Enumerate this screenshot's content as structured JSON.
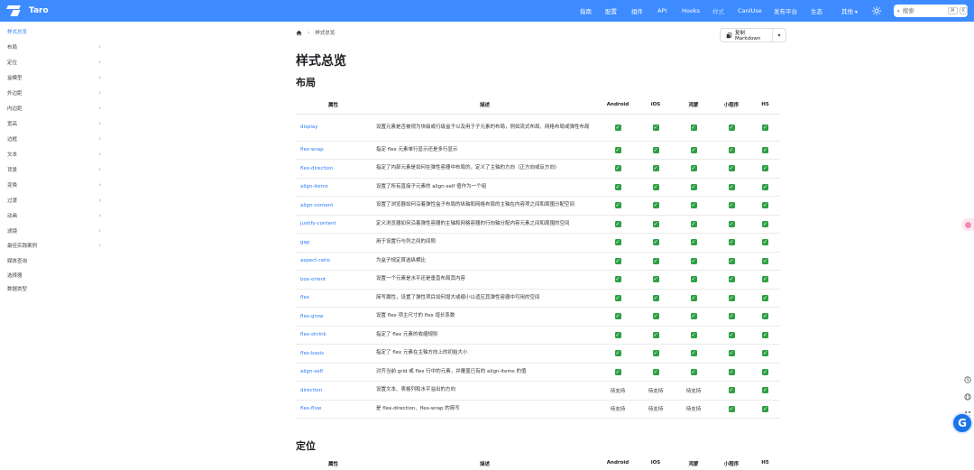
{
  "navbar": {
    "brand": "Taro",
    "items": [
      {
        "label": "指南",
        "muted": false
      },
      {
        "label": "配置",
        "muted": false
      },
      {
        "label": "组件",
        "muted": false
      },
      {
        "label": "API",
        "muted": false
      },
      {
        "label": "Hooks",
        "muted": false
      },
      {
        "label": "样式",
        "muted": true
      },
      {
        "label": "CanIUse",
        "muted": false
      },
      {
        "label": "发布平台",
        "muted": false
      },
      {
        "label": "生态",
        "muted": false
      },
      {
        "label": "其他",
        "muted": false,
        "dropdown": true
      }
    ],
    "search_placeholder": "搜索",
    "search_kbd": [
      "⌘",
      "K"
    ]
  },
  "sidebar": {
    "items": [
      {
        "label": "样式总览",
        "active": true,
        "chevron": false
      },
      {
        "label": "布局",
        "chevron": true
      },
      {
        "label": "定位",
        "chevron": true
      },
      {
        "label": "盒模型",
        "chevron": true
      },
      {
        "label": "外边距",
        "chevron": true
      },
      {
        "label": "内边距",
        "chevron": true
      },
      {
        "label": "宽高",
        "chevron": true
      },
      {
        "label": "边框",
        "chevron": true
      },
      {
        "label": "文本",
        "chevron": true
      },
      {
        "label": "背景",
        "chevron": true
      },
      {
        "label": "变换",
        "chevron": true
      },
      {
        "label": "过渡",
        "chevron": true
      },
      {
        "label": "动画",
        "chevron": true
      },
      {
        "label": "滤镜",
        "chevron": true
      },
      {
        "label": "最佳实践案例",
        "chevron": true
      },
      {
        "label": "媒体查询",
        "chevron": false
      },
      {
        "label": "选择器",
        "chevron": false
      },
      {
        "label": "数据类型",
        "chevron": false
      }
    ]
  },
  "breadcrumb": {
    "current": "样式总览"
  },
  "copy_button": {
    "label": "复制 Markdown"
  },
  "page_title": "样式总览",
  "sections": [
    {
      "title": "布局",
      "headers": [
        "属性",
        "描述",
        "Android",
        "iOS",
        "鸿蒙",
        "小程序",
        "H5"
      ],
      "rows": [
        {
          "prop": "display",
          "desc": "设置元素是否被视为块级或行级盒子以及用于子元素的布局，例如流式布局、网格布局或弹性布局",
          "support": [
            "✓",
            "✓",
            "✓",
            "✓",
            "✓"
          ],
          "tall": true
        },
        {
          "prop": "flex-wrap",
          "desc": "指定 flex 元素单行显示还是多行显示",
          "support": [
            "✓",
            "✓",
            "✓",
            "✓",
            "✓"
          ]
        },
        {
          "prop": "flex-direction",
          "desc": "指定了内部元素是如何在弹性容器中布局的，定义了主轴的方向（正方向或反方向）",
          "support": [
            "✓",
            "✓",
            "✓",
            "✓",
            "✓"
          ]
        },
        {
          "prop": "align-items",
          "desc": "设置了所有直接子元素的 align-self 值作为一个组",
          "support": [
            "✓",
            "✓",
            "✓",
            "✓",
            "✓"
          ]
        },
        {
          "prop": "align-content",
          "desc": "设置了浏览器如何沿着弹性盒子布局的纵轴和网格布局的主轴在内容项之间和周围分配空间",
          "support": [
            "✓",
            "✓",
            "✓",
            "✓",
            "✓"
          ]
        },
        {
          "prop": "justify-content",
          "desc": "定义浏览器如何沿着弹性容器的主轴和网格容器的行向轴分配内容元素之间和周围的空间",
          "support": [
            "✓",
            "✓",
            "✓",
            "✓",
            "✓"
          ]
        },
        {
          "prop": "gap",
          "desc": "用于设置行与列之间的间隙",
          "support": [
            "✓",
            "✓",
            "✓",
            "✓",
            "✓"
          ]
        },
        {
          "prop": "aspect-ratio",
          "desc": "为盒子规定首选纵横比",
          "support": [
            "✓",
            "✓",
            "✓",
            "✓",
            "✓"
          ]
        },
        {
          "prop": "box-orient",
          "desc": "设置一个元素是水平还是垂直布局其内容",
          "support": [
            "✓",
            "✓",
            "✓",
            "✓",
            "✓"
          ]
        },
        {
          "prop": "flex",
          "desc": "简写属性，设置了弹性项目如何增大或缩小以适应其弹性容器中可用的空间",
          "support": [
            "✓",
            "✓",
            "✓",
            "✓",
            "✓"
          ]
        },
        {
          "prop": "flex-grow",
          "desc": "设置 flex 项主尺寸的 flex 增长系数",
          "support": [
            "✓",
            "✓",
            "✓",
            "✓",
            "✓"
          ]
        },
        {
          "prop": "flex-shrink",
          "desc": "指定了 flex 元素的收缩规则",
          "support": [
            "✓",
            "✓",
            "✓",
            "✓",
            "✓"
          ]
        },
        {
          "prop": "flex-basis",
          "desc": "指定了 flex 元素在主轴方向上的初始大小",
          "support": [
            "✓",
            "✓",
            "✓",
            "✓",
            "✓"
          ]
        },
        {
          "prop": "align-self",
          "desc": "对齐当前 grid 或 flex 行中的元素，并覆盖已有的 align-items 的值",
          "support": [
            "✓",
            "✓",
            "✓",
            "✓",
            "✓"
          ]
        },
        {
          "prop": "direction",
          "desc": "设置文本、表格列和水平溢出的方向",
          "support": [
            "待支持",
            "待支持",
            "待支持",
            "✓",
            "✓"
          ]
        },
        {
          "prop": "flex-flow",
          "desc": "是 flex-direction、flex-wrap 的简写",
          "support": [
            "待支持",
            "待支持",
            "待支持",
            "✓",
            "✓"
          ]
        }
      ]
    },
    {
      "title": "定位",
      "headers": [
        "属性",
        "描述",
        "Android",
        "iOS",
        "鸿蒙",
        "小程序",
        "H5"
      ]
    }
  ],
  "colors": {
    "navbar": "#3d8bff",
    "link": "#2a7bf6",
    "check": "#2ea043"
  }
}
